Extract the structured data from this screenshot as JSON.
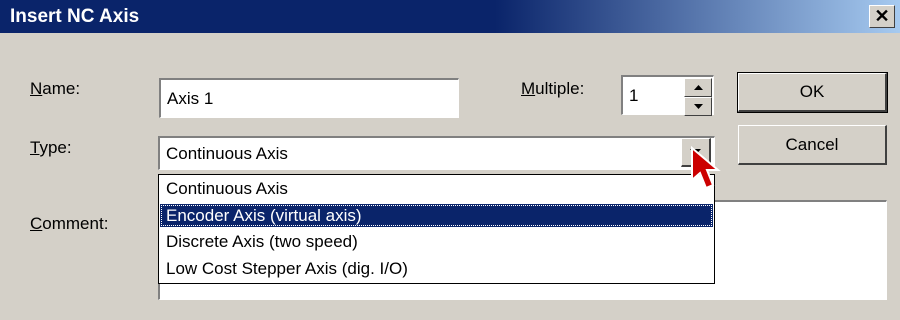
{
  "dialog": {
    "title": "Insert NC Axis",
    "close_glyph": "✕"
  },
  "name": {
    "label_key": "N",
    "label_rest": "ame:",
    "value": "Axis 1"
  },
  "multiple": {
    "label_key": "M",
    "label_rest": "ultiple:",
    "value": "1"
  },
  "type": {
    "label_key": "T",
    "label_rest": "ype:",
    "value": "Continuous Axis",
    "options": [
      "Continuous Axis",
      "Encoder Axis (virtual axis)",
      "Discrete Axis (two speed)",
      "Low Cost Stepper Axis (dig. I/O)"
    ],
    "highlighted_option": "Encoder Axis (virtual axis)"
  },
  "comment": {
    "label_key": "C",
    "label_rest": "omment:",
    "value": ""
  },
  "buttons": {
    "ok": "OK",
    "cancel": "Cancel"
  },
  "icons": {
    "cursor": "arrow-pointer-icon",
    "spin_up": "up-arrow-icon",
    "spin_down": "down-arrow-icon",
    "dropdown": "chevron-down-icon"
  },
  "colors": {
    "title_bar": "#0a246a",
    "dialog_bg": "#d4d0c8",
    "selection": "#0a246a",
    "cursor": "#cc0000"
  }
}
